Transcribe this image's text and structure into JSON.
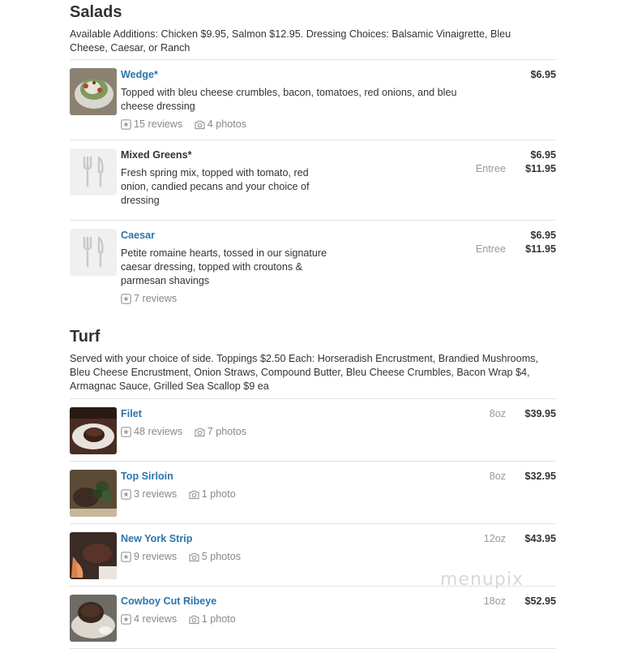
{
  "salads": {
    "title": "Salads",
    "description": "Available Additions: Chicken $9.95, Salmon $12.95. Dressing Choices: Balsamic Vinaigrette, Bleu Cheese, Caesar, or Ranch",
    "items": [
      {
        "name": "Wedge*",
        "description": "Topped with bleu cheese crumbles, bacon, tomatoes, red onions, and bleu cheese dressing",
        "reviews": "15 reviews",
        "photos": "4 photos",
        "price": "$6.95"
      },
      {
        "name": "Mixed Greens*",
        "description": "Fresh spring mix, topped with tomato, red onion, candied pecans and your choice of dressing",
        "price": "$6.95",
        "entree_label": "Entree",
        "entree_price": "$11.95"
      },
      {
        "name": "Caesar",
        "description": "Petite romaine hearts, tossed in our signature caesar dressing, topped with croutons & parmesan shavings",
        "reviews": "7 reviews",
        "price": "$6.95",
        "entree_label": "Entree",
        "entree_price": "$11.95"
      }
    ]
  },
  "turf": {
    "title": "Turf",
    "description": "Served with your choice of side. Toppings $2.50 Each: Horseradish Encrustment, Brandied Mushrooms, Bleu Cheese Encrustment, Onion Straws, Compound Butter, Bleu Cheese Crumbles, Bacon Wrap $4, Armagnac Sauce, Grilled Sea Scallop $9 ea",
    "items": [
      {
        "name": "Filet",
        "reviews": "48 reviews",
        "photos": "7 photos",
        "size": "8oz",
        "price": "$39.95"
      },
      {
        "name": "Top Sirloin",
        "reviews": "3 reviews",
        "photos": "1 photo",
        "size": "8oz",
        "price": "$32.95"
      },
      {
        "name": "New York Strip",
        "reviews": "9 reviews",
        "photos": "5 photos",
        "size": "12oz",
        "price": "$43.95"
      },
      {
        "name": "Cowboy Cut Ribeye",
        "reviews": "4 reviews",
        "photos": "1 photo",
        "size": "18oz",
        "price": "$52.95"
      }
    ]
  },
  "watermark": "menupix",
  "colors": {
    "link": "#2b75ac",
    "text": "#333333",
    "muted": "#888888",
    "divider": "#e2e2e2"
  },
  "icons": {
    "reviews": "star-box-icon",
    "photos": "camera-icon",
    "placeholder": "fork-knife-icon"
  }
}
